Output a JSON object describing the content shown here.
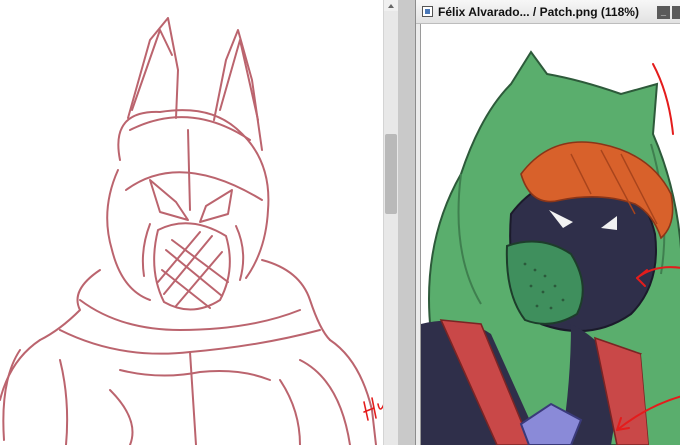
{
  "document_window": {
    "title": "Félix Alvarado... / Patch.png (118%)",
    "minimize_label": "_"
  },
  "scrollbar": {
    "position_fraction": 0.3
  },
  "colors": {
    "sketch_stroke": "#b04a55",
    "hood_green": "#5aae6d",
    "hair_orange": "#d8612b",
    "mask_dark": "#2f2f4a",
    "annotation_red": "#e41c1c"
  }
}
